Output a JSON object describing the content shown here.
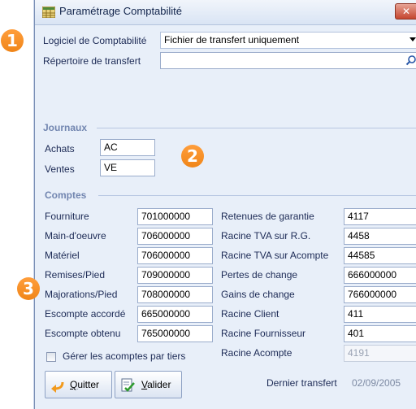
{
  "window": {
    "title": "Paramétrage Comptabilité",
    "close_label": "✕"
  },
  "header": {
    "software_label": "Logiciel de Comptabilité",
    "software_value": "Fichier de transfert uniquement",
    "directory_label": "Répertoire de transfert",
    "directory_value": ""
  },
  "journaux": {
    "title": "Journaux",
    "rows": [
      {
        "label": "Achats",
        "value": "AC"
      },
      {
        "label": "Ventes",
        "value": "VE"
      }
    ]
  },
  "comptes": {
    "title": "Comptes",
    "left": [
      {
        "label": "Fourniture",
        "value": "701000000"
      },
      {
        "label": "Main-d'oeuvre",
        "value": "706000000"
      },
      {
        "label": "Matériel",
        "value": "706000000"
      },
      {
        "label": "Remises/Pied",
        "value": "709000000"
      },
      {
        "label": "Majorations/Pied",
        "value": "708000000"
      },
      {
        "label": "Escompte accordé",
        "value": "665000000"
      },
      {
        "label": "Escompte obtenu",
        "value": "765000000"
      }
    ],
    "right": [
      {
        "label": "Retenues de garantie",
        "value": "4117"
      },
      {
        "label": "Racine TVA sur R.G.",
        "value": "4458"
      },
      {
        "label": "Racine TVA sur Acompte",
        "value": "44585"
      },
      {
        "label": "Pertes de change",
        "value": "666000000"
      },
      {
        "label": "Gains de change",
        "value": "766000000"
      },
      {
        "label": "Racine Client",
        "value": "411"
      },
      {
        "label": "Racine Fournisseur",
        "value": "401"
      },
      {
        "label": "Racine Acompte",
        "value": "4191"
      }
    ],
    "checkbox_label": "Gérer les acomptes par tiers"
  },
  "footer": {
    "quit_label_underlined": "Q",
    "quit_label_rest": "uitter",
    "validate_label_underlined": "V",
    "validate_label_rest": "alider",
    "last_transfer_label": "Dernier transfert",
    "last_transfer_date": "02/09/2005"
  },
  "badges": [
    "1",
    "2",
    "3"
  ],
  "colors": {
    "badge": "#f08518",
    "section_title": "#7286b0",
    "window_bg": "#e8eff9"
  }
}
